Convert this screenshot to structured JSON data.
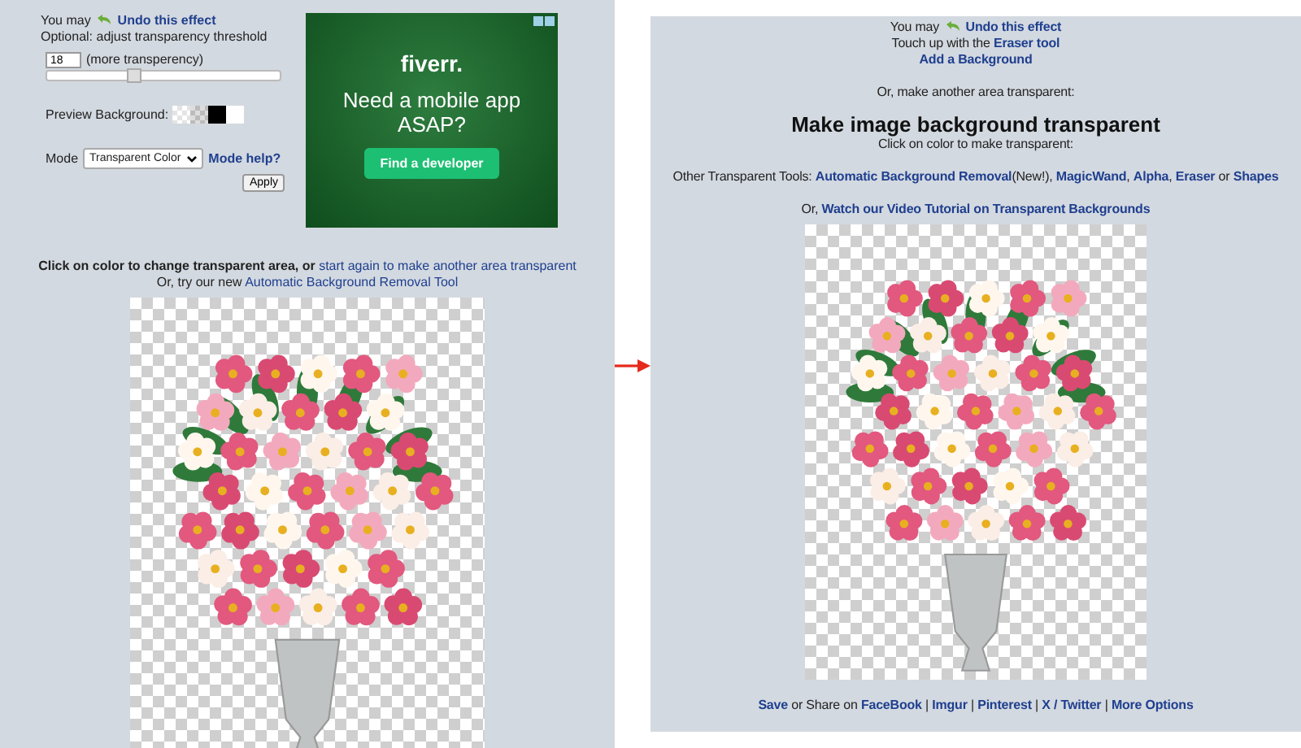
{
  "editor": {
    "undo": {
      "prefix": "You may ",
      "link": "Undo this effect"
    },
    "hint": "Optional: adjust transparency threshold",
    "threshold": {
      "value": "18",
      "label": "(more transperency)",
      "level": 0.37
    },
    "preview_background": {
      "label": "Preview Background:",
      "swatches": [
        {
          "kind": "checker-light"
        },
        {
          "kind": "checker-gray"
        },
        {
          "kind": "black"
        },
        {
          "kind": "white"
        }
      ]
    },
    "mode": {
      "label": "Mode",
      "value": "Transparent Color",
      "help": "Mode help?"
    },
    "apply": "Apply",
    "ad": {
      "logo": "fiverr.",
      "headline": "Need a mobile app ASAP?",
      "button": "Find a developer"
    },
    "instructions": [
      [
        {
          "text": "Click on color to change transparent area, or ",
          "kind": "bold"
        },
        {
          "text": "start again to make another area transparent",
          "kind": "link"
        }
      ],
      [
        {
          "text": "Or, try our new ",
          "kind": "text"
        },
        {
          "text": "Automatic Background Removal Tool",
          "kind": "link"
        }
      ]
    ]
  },
  "result": {
    "undo": {
      "prefix": "You may ",
      "link": "Undo this effect"
    },
    "touch_up": [
      {
        "text": "Touch up with the ",
        "kind": "text"
      },
      {
        "text": "Eraser tool",
        "kind": "link"
      }
    ],
    "add_background": "Add a Background",
    "another_area": "Or, make another area transparent:",
    "heading": "Make image background transparent",
    "subheading": "Click on color to make transparent:",
    "tools": [
      {
        "text": "Other Transparent Tools: ",
        "kind": "text"
      },
      {
        "text": "Automatic Background Removal",
        "kind": "link"
      },
      {
        "text": "(New!), ",
        "kind": "text"
      },
      {
        "text": "MagicWand",
        "kind": "link"
      },
      {
        "text": ", ",
        "kind": "text"
      },
      {
        "text": "Alpha",
        "kind": "link"
      },
      {
        "text": ", ",
        "kind": "text"
      },
      {
        "text": "Eraser",
        "kind": "link"
      },
      {
        "text": " or ",
        "kind": "text"
      },
      {
        "text": "Shapes",
        "kind": "link"
      }
    ],
    "video": [
      {
        "text": "Or, ",
        "kind": "text"
      },
      {
        "text": "Watch our Video Tutorial on Transparent Backgrounds",
        "kind": "link"
      }
    ],
    "share": [
      {
        "text": "Save",
        "kind": "link"
      },
      {
        "text": " or Share on ",
        "kind": "text"
      },
      {
        "text": "FaceBook",
        "kind": "link"
      },
      {
        "text": " | ",
        "kind": "text"
      },
      {
        "text": "Imgur",
        "kind": "link"
      },
      {
        "text": " | ",
        "kind": "text"
      },
      {
        "text": "Pinterest",
        "kind": "link"
      },
      {
        "text": " | ",
        "kind": "text"
      },
      {
        "text": "X / Twitter",
        "kind": "link"
      },
      {
        "text": " | ",
        "kind": "text"
      },
      {
        "text": "More Options",
        "kind": "link"
      }
    ]
  }
}
